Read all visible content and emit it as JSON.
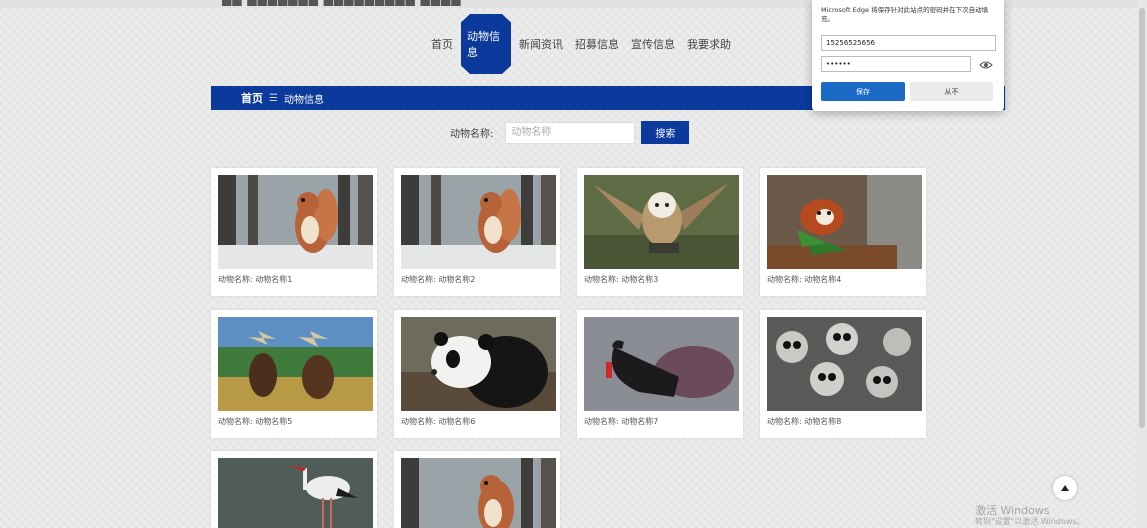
{
  "header": {
    "site_title": "▇▇ ▇▇▇▇▇▇▇ ▇▇▇▇▇▇▇▇▇ ▇▇▇▇"
  },
  "nav": {
    "items": [
      {
        "label": "首页"
      },
      {
        "label": "动物信息",
        "active": true
      },
      {
        "label": "新闻资讯"
      },
      {
        "label": "招募信息"
      },
      {
        "label": "宣传信息"
      },
      {
        "label": "我要求助"
      }
    ]
  },
  "breadcrumb": {
    "home": "首页",
    "separator": "☰",
    "current": "动物信息"
  },
  "search": {
    "label": "动物名称:",
    "placeholder": "动物名称",
    "button": "搜索"
  },
  "animals": {
    "caption_prefix": "动物名称:",
    "items": [
      {
        "name": "动物名称1",
        "image": "squirrel"
      },
      {
        "name": "动物名称2",
        "image": "squirrel"
      },
      {
        "name": "动物名称3",
        "image": "owl"
      },
      {
        "name": "动物名称4",
        "image": "red-panda"
      },
      {
        "name": "动物名称5",
        "image": "moose"
      },
      {
        "name": "动物名称6",
        "image": "panda"
      },
      {
        "name": "动物名称7",
        "image": "black-swan"
      },
      {
        "name": "动物名称8",
        "image": "lemurs"
      },
      {
        "name": "",
        "image": "stork"
      },
      {
        "name": "",
        "image": "squirrel"
      }
    ]
  },
  "password_dialog": {
    "message": "Microsoft Edge 将保存针对此站点的密码并在下次自动填充。",
    "username": "15256525656",
    "password": "••••••",
    "save_label": "保存",
    "cancel_label": "从不"
  },
  "watermark": {
    "line1": "激活 Windows",
    "line2": "转到\"设置\"以激活 Windows。"
  },
  "colors": {
    "brand": "#0c3a9c",
    "save_button": "#1b6ac6"
  }
}
